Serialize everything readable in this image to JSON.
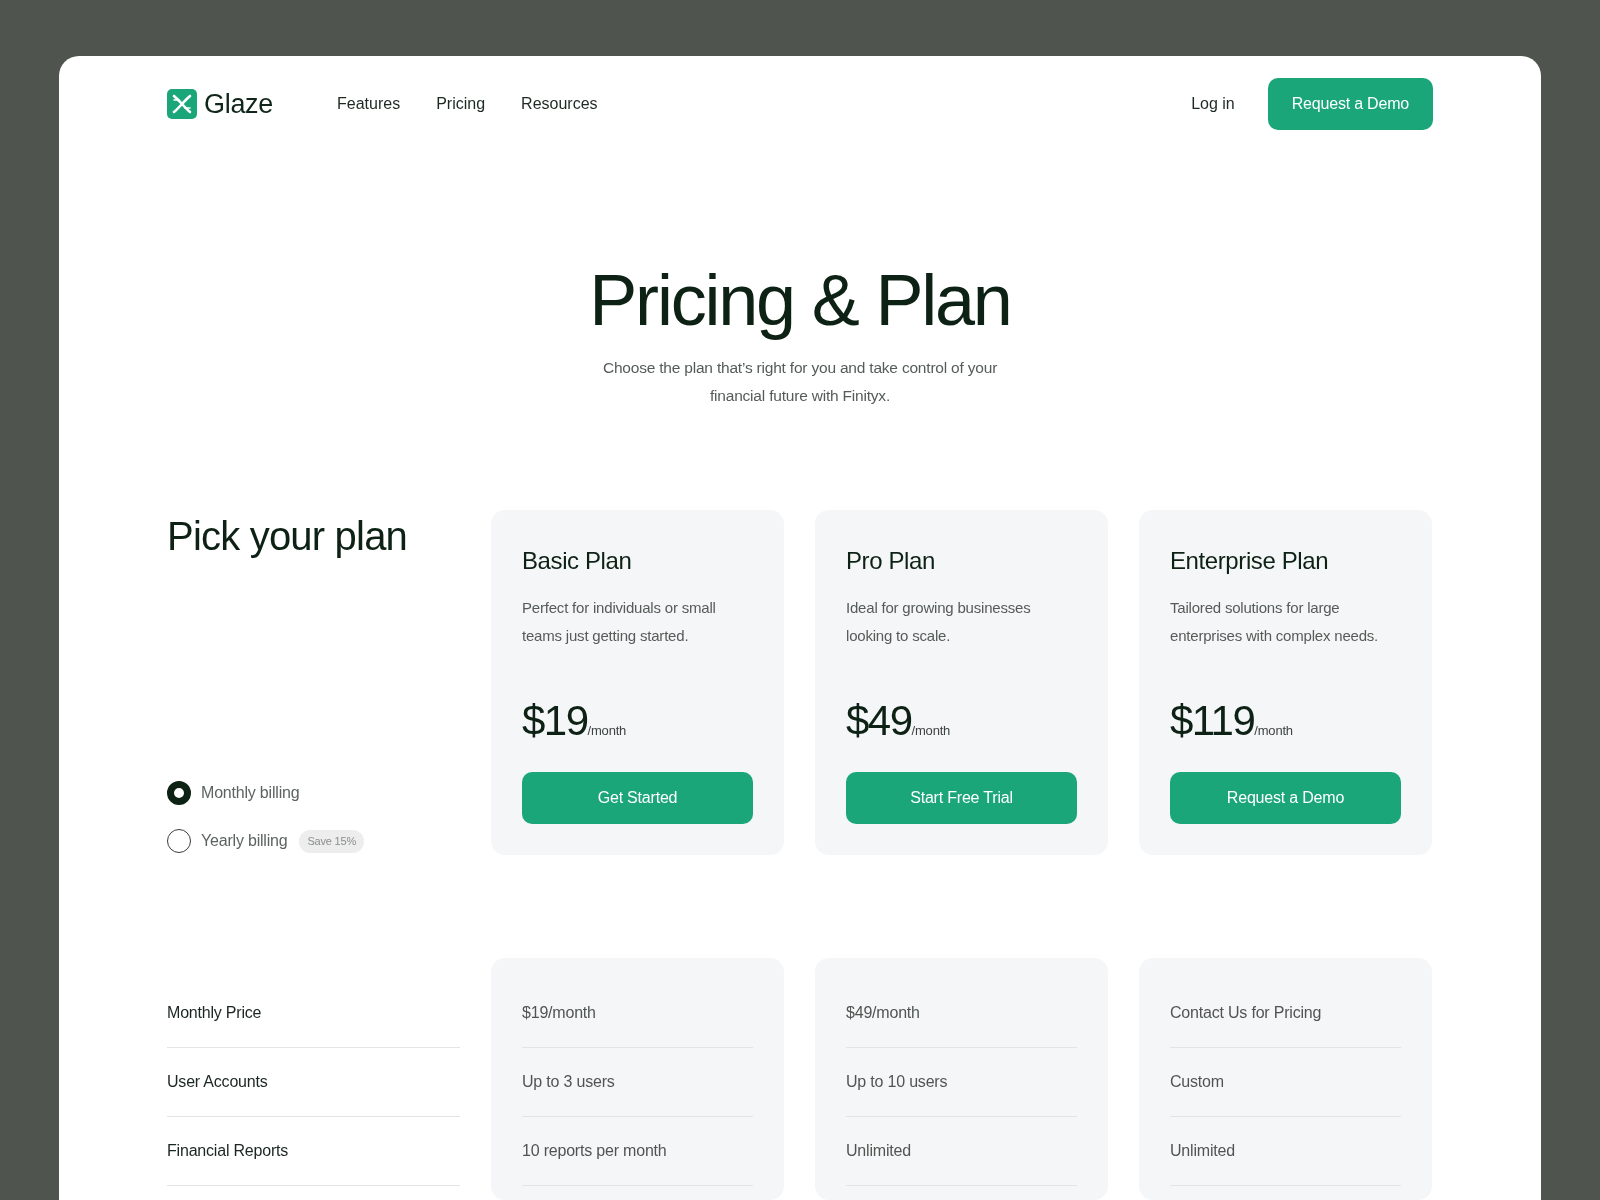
{
  "nav": {
    "brand": "Glaze",
    "links": [
      {
        "label": "Features"
      },
      {
        "label": "Pricing"
      },
      {
        "label": "Resources"
      }
    ],
    "login": "Log in",
    "cta": "Request a Demo"
  },
  "hero": {
    "title": "Pricing & Plan",
    "subtitle": "Choose the plan that’s right for you and take control of your financial future with Finityx."
  },
  "plan_picker": {
    "heading": "Pick your plan",
    "billing_options": [
      {
        "label": "Monthly billing",
        "selected": true
      },
      {
        "label": "Yearly billing",
        "selected": false,
        "badge": "Save 15%"
      }
    ]
  },
  "plans": [
    {
      "name": "Basic Plan",
      "description": "Perfect for individuals or small teams just getting started.",
      "price": "$19",
      "period": "/month",
      "button": "Get Started"
    },
    {
      "name": "Pro Plan",
      "description": "Ideal for growing businesses looking to scale.",
      "price": "$49",
      "period": "/month",
      "button": "Start Free Trial"
    },
    {
      "name": "Enterprise Plan",
      "description": "Tailored solutions for large enterprises with complex needs.",
      "price": "$119",
      "period": "/month",
      "button": "Request a Demo"
    }
  ],
  "comparison": {
    "rows": [
      {
        "label": "Monthly Price",
        "values": [
          "$19/month",
          "$49/month",
          "Contact Us for Pricing"
        ]
      },
      {
        "label": "User Accounts",
        "values": [
          "Up to 3 users",
          "Up to 10 users",
          "Custom"
        ]
      },
      {
        "label": "Financial Reports",
        "values": [
          "10 reports per month",
          "Unlimited",
          "Unlimited"
        ]
      }
    ]
  }
}
